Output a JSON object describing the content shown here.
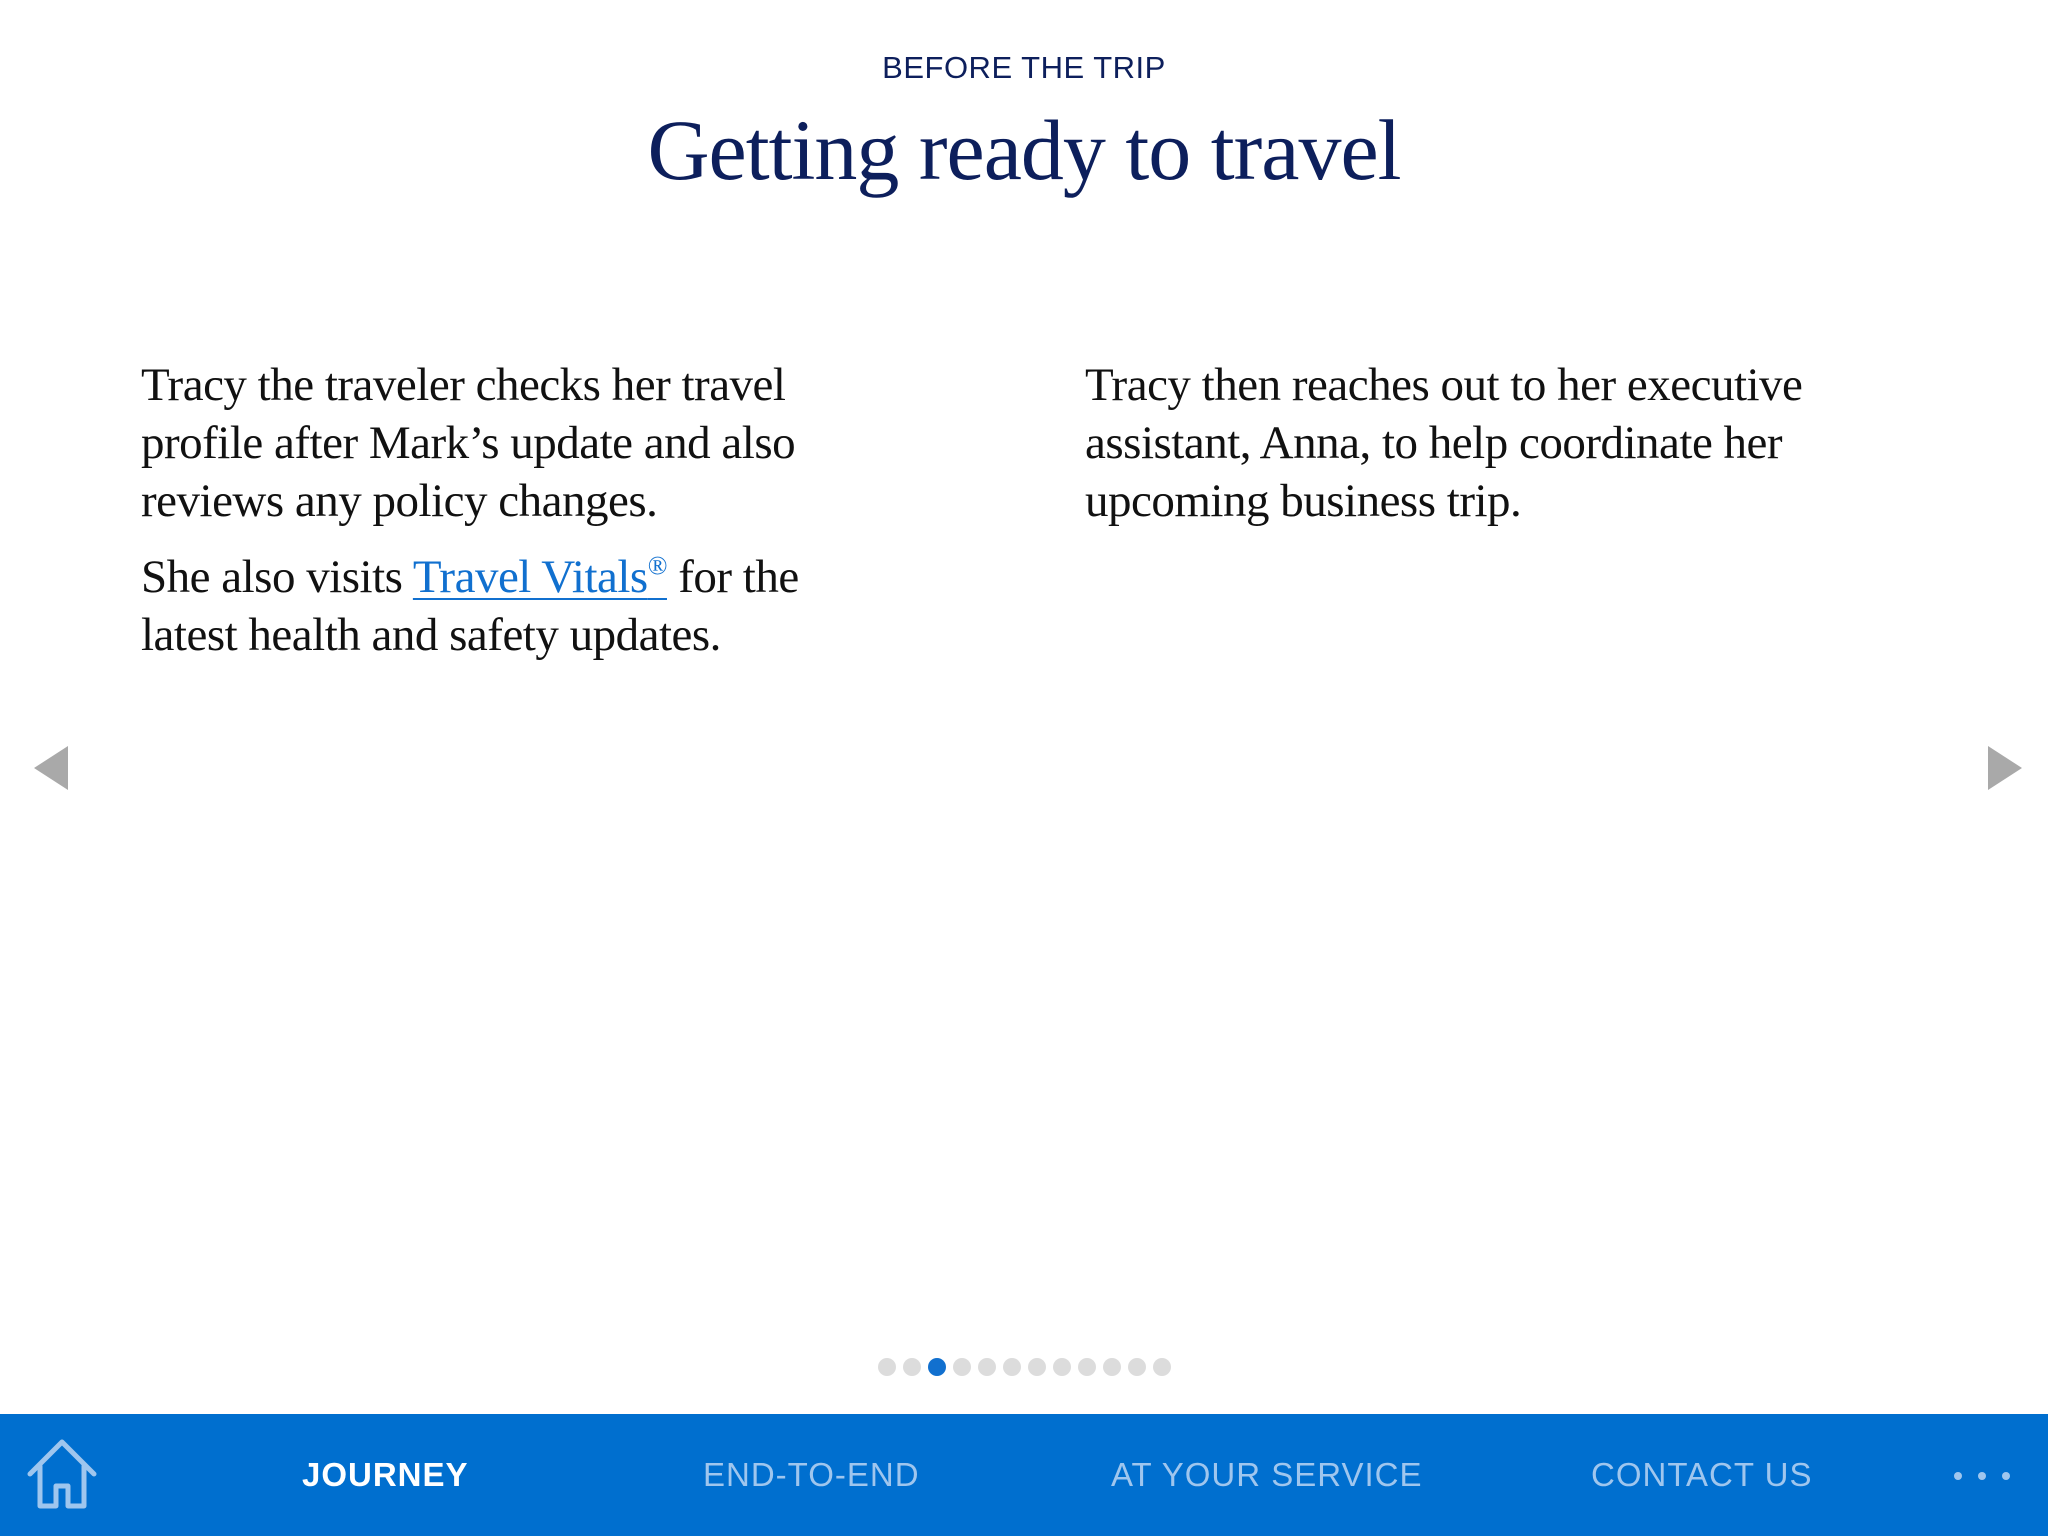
{
  "header": {
    "eyebrow": "BEFORE THE TRIP",
    "title": "Getting ready to travel"
  },
  "content": {
    "left": {
      "paragraph1": "Tracy the traveler checks her travel profile after Mark’s update and also reviews any policy changes.",
      "paragraph2_before_link": "She also visits ",
      "link_text": "Travel Vitals",
      "link_mark": "®",
      "paragraph2_after_link": " for the latest health and safety updates."
    },
    "right": {
      "paragraph1": "Tracy then reaches out to her executive assistant, Anna, to help coordinate her upcoming business trip."
    }
  },
  "pager": {
    "total_pages": 12,
    "current_page": 3
  },
  "navbar": {
    "items": [
      {
        "label": "JOURNEY",
        "active": true
      },
      {
        "label": "END-TO-END",
        "active": false
      },
      {
        "label": "AT YOUR SERVICE",
        "active": false
      },
      {
        "label": "CONTACT US",
        "active": false
      }
    ],
    "icons": {
      "home": "home-icon",
      "more": "more-icon",
      "prev": "chevron-left-icon",
      "next": "chevron-right-icon"
    }
  },
  "colors": {
    "brand_blue": "#006fcf",
    "heading_navy": "#0d1f5c",
    "link_blue": "#1170cf",
    "nav_inactive": "#9fc6ee",
    "arrow_gray": "#a9a9a9",
    "dot_inactive": "#dcdcdc"
  }
}
